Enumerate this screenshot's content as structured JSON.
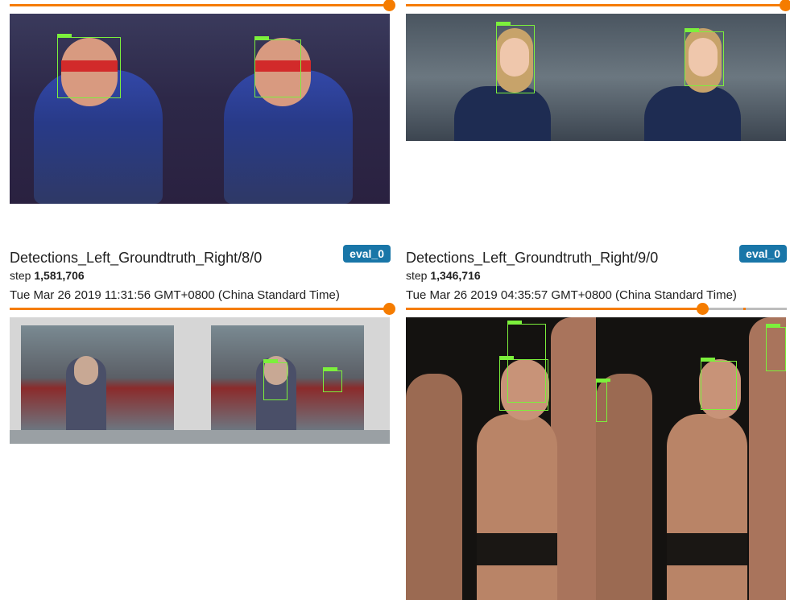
{
  "cards": [
    {
      "title": "",
      "step_label": "",
      "step_value": "",
      "timestamp": "",
      "run": "",
      "slider_fraction": 1.0
    },
    {
      "title": "",
      "step_label": "",
      "step_value": "",
      "timestamp": "",
      "run": "",
      "slider_fraction": 1.0
    },
    {
      "title": "Detections_Left_Groundtruth_Right/8/0",
      "step_label": "step",
      "step_value": "1,581,706",
      "timestamp": "Tue Mar 26 2019 11:31:56 GMT+0800 (China Standard Time)",
      "run": "eval_0",
      "slider_fraction": 1.0
    },
    {
      "title": "Detections_Left_Groundtruth_Right/9/0",
      "step_label": "step",
      "step_value": "1,346,716",
      "timestamp": "Tue Mar 26 2019 04:35:57 GMT+0800 (China Standard Time)",
      "run": "eval_0",
      "slider_fraction": 0.78
    }
  ],
  "colors": {
    "accent": "#f57c00",
    "badge": "#1976a8",
    "bbox": "#7cf03c"
  },
  "images": [
    "child-superhero-detection-pair",
    "woman-portrait-detection-pair",
    "laptop-video-call-detection-pair",
    "group-women-detection-pair"
  ]
}
